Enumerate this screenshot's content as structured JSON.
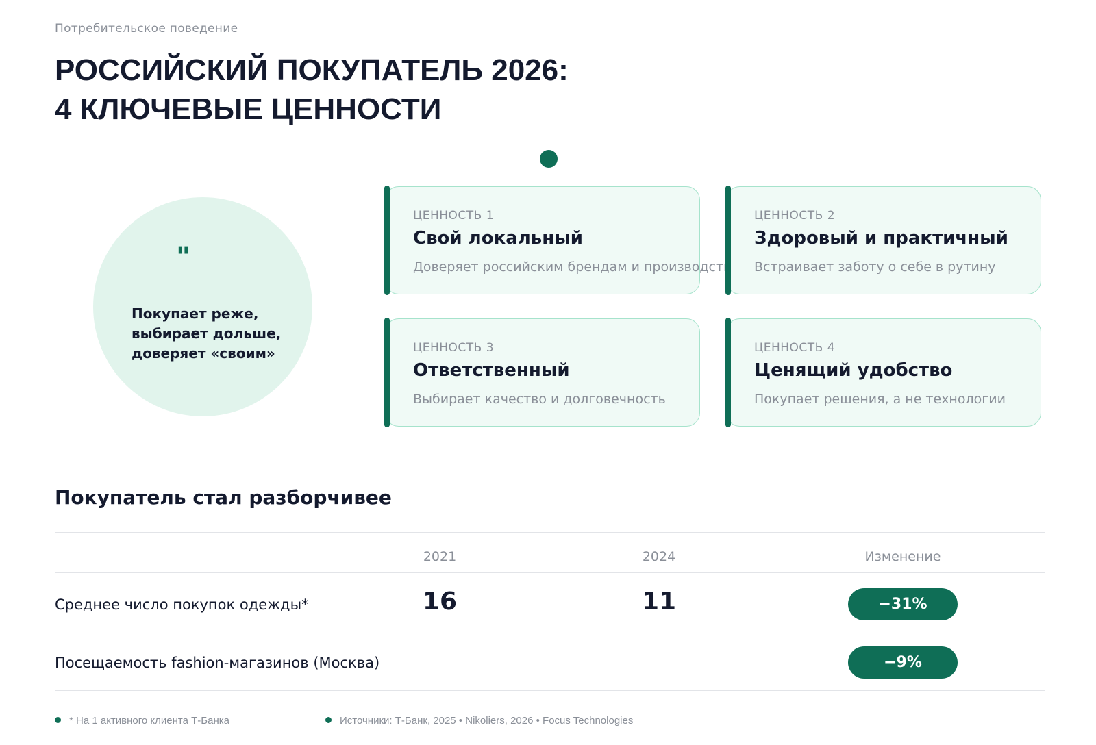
{
  "header": {
    "eyebrow": "Потребительское поведение",
    "title_line1": "РОССИЙСКИЙ ПОКУПАТЕЛЬ 2026:",
    "title_line2": "4 КЛЮЧЕВЫЕ ЦЕННОСТИ"
  },
  "quote": {
    "mark": "\"",
    "text": "Покупает реже, выбирает дольше, доверяет «своим»"
  },
  "values": [
    {
      "label": "ЦЕННОСТЬ 1",
      "name": "Свой локальный",
      "desc": "Доверяет российским брендам и производству"
    },
    {
      "label": "ЦЕННОСТЬ 2",
      "name": "Здоровый и практичный",
      "desc": "Встраивает заботу о себе в рутину"
    },
    {
      "label": "ЦЕННОСТЬ 3",
      "name": "Ответственный",
      "desc": "Выбирает качество и долговечность"
    },
    {
      "label": "ЦЕННОСТЬ 4",
      "name": "Ценящий удобство",
      "desc": "Покупает решения, а не технологии"
    }
  ],
  "table": {
    "title": "Покупатель стал разборчивее",
    "columns": [
      "2021",
      "2024",
      "Изменение"
    ],
    "rows": [
      {
        "label": "Среднее число покупок одежды*",
        "v2021": "16",
        "v2024": "11",
        "change": "−31%"
      },
      {
        "label": "Посещаемость fashion-магазинов (Москва)",
        "v2021": "",
        "v2024": "",
        "change": "−9%"
      }
    ]
  },
  "footnotes": {
    "note": "* На 1 активного клиента Т-Банка",
    "sources": "Источники: Т-Банк, 2025 • Nikoliers, 2026 • Focus Technologies"
  },
  "colors": {
    "accent": "#0f6e56",
    "card_bg": "#f0faf6",
    "card_border": "#a6e3cc",
    "circle_bg": "#e1f4ec"
  }
}
